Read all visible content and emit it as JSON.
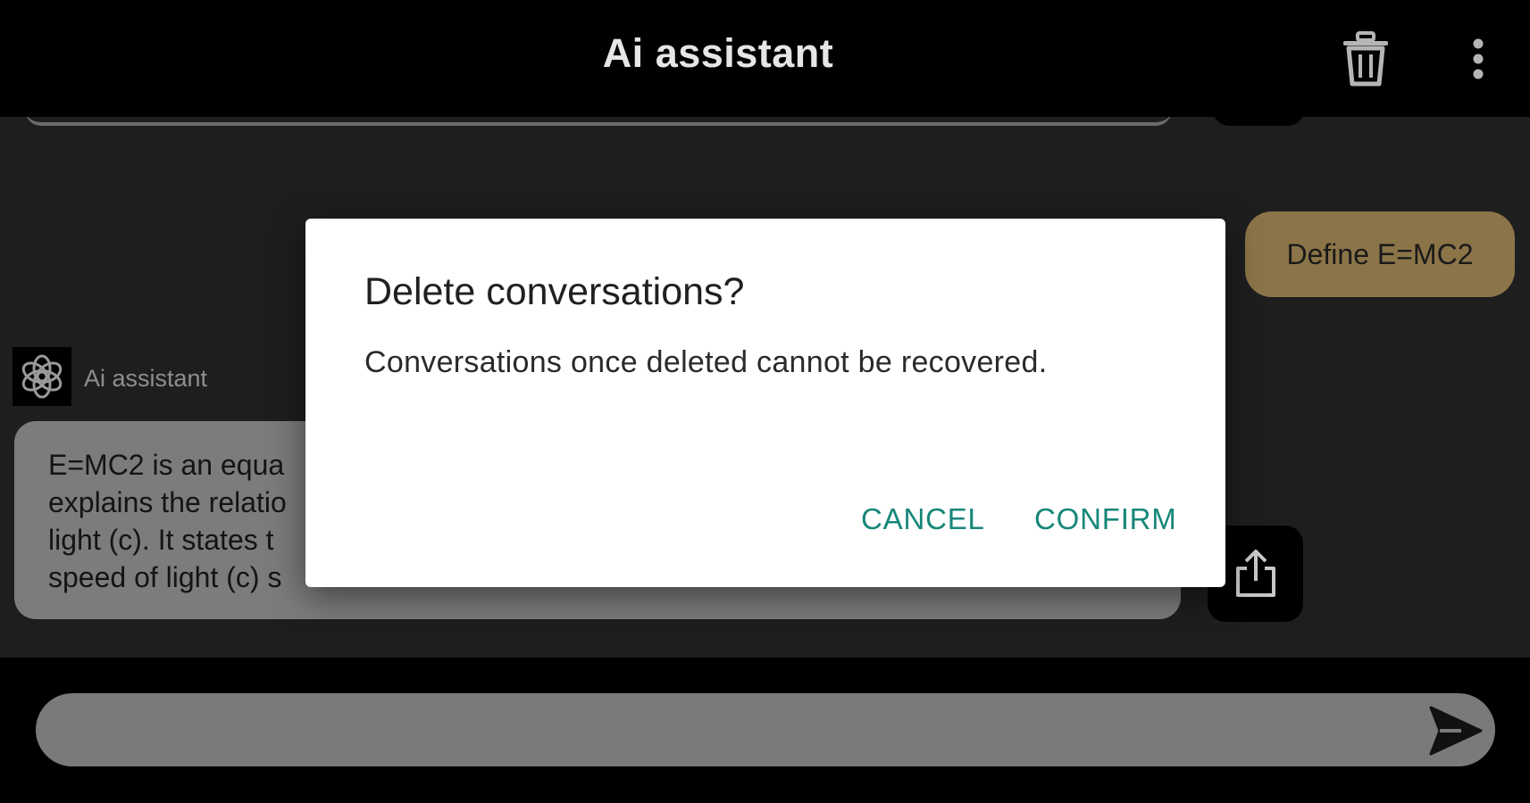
{
  "appbar": {
    "title": "Ai assistant",
    "actions": [
      {
        "icon": "trash-icon"
      },
      {
        "icon": "more-vert-icon"
      }
    ]
  },
  "chat": {
    "user_message": "Define E=MC2",
    "assistant": {
      "name": "Ai assistant",
      "avatar_icon": "openai-logo-icon",
      "message_lines": [
        "E=MC2 is an equa",
        "explains the relatio",
        "light (c). It states t",
        "speed of light (c) s"
      ],
      "share_icon": "share-icon"
    }
  },
  "input": {
    "placeholder": "",
    "send_icon": "send-icon"
  },
  "dialog": {
    "title": "Delete conversations?",
    "message": "Conversations once deleted cannot be recovered.",
    "cancel_label": "CANCEL",
    "confirm_label": "CONFIRM"
  },
  "colors": {
    "background": "#000000",
    "chat_background": "#1e1e1e",
    "user_bubble": "#8b7548",
    "assistant_bubble": "#7c7c7c",
    "dialog_button": "#168779"
  }
}
